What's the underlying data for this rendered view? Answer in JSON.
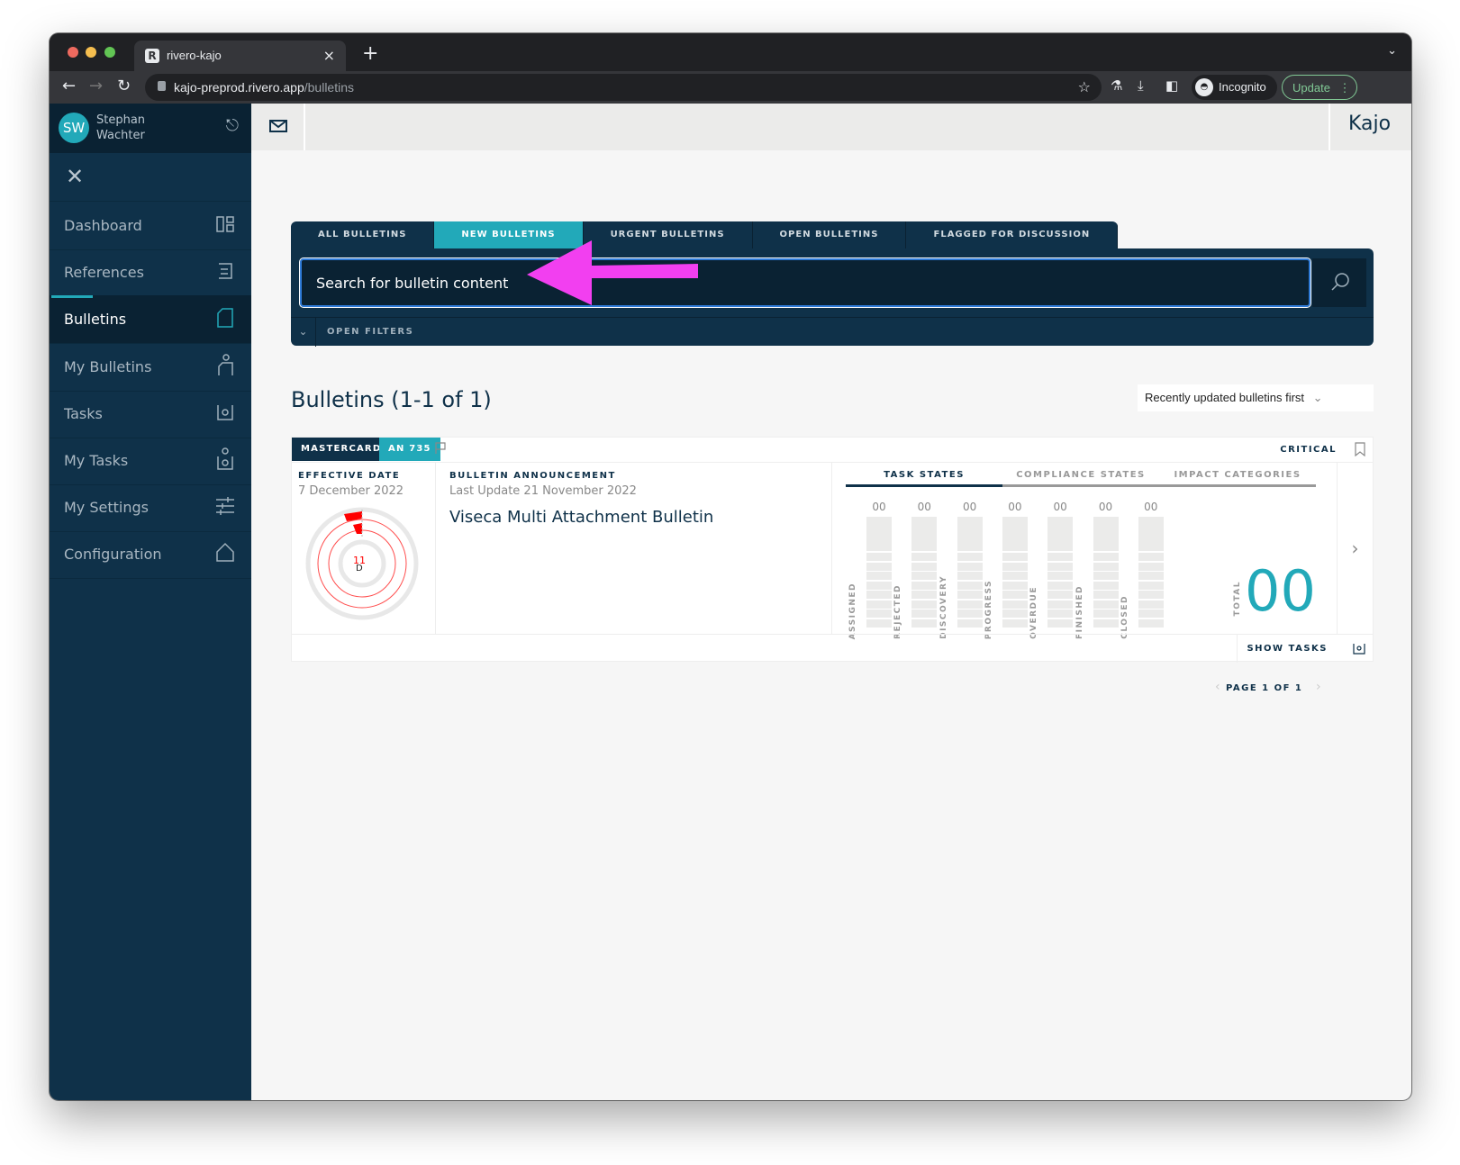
{
  "browser": {
    "tab_title": "rivero-kajo",
    "tab_favicon": "R",
    "url_host": "kajo-preprod.rivero.app",
    "url_path": "/bulletins",
    "profile_label": "Incognito",
    "update_label": "Update"
  },
  "user": {
    "initials": "SW",
    "first_name": "Stephan",
    "last_name": "Wachter"
  },
  "brand": "Kajo",
  "sidebar": {
    "items": [
      {
        "label": "Dashboard",
        "icon": "dashboard-icon"
      },
      {
        "label": "References",
        "icon": "references-icon"
      },
      {
        "label": "Bulletins",
        "icon": "bulletin-icon",
        "active": true
      },
      {
        "label": "My Bulletins",
        "icon": "my-bulletins-icon"
      },
      {
        "label": "Tasks",
        "icon": "tasks-icon"
      },
      {
        "label": "My Tasks",
        "icon": "my-tasks-icon"
      },
      {
        "label": "My Settings",
        "icon": "settings-sliders-icon"
      },
      {
        "label": "Configuration",
        "icon": "home-icon"
      }
    ]
  },
  "filter_tabs": [
    {
      "label": "ALL BULLETINS"
    },
    {
      "label": "NEW BULLETINS",
      "active": true
    },
    {
      "label": "URGENT BULLETINS"
    },
    {
      "label": "OPEN BULLETINS"
    },
    {
      "label": "FLAGGED FOR DISCUSSION"
    }
  ],
  "search": {
    "value": "Search for bulletin content",
    "open_filters_label": "OPEN FILTERS"
  },
  "results": {
    "title": "Bulletins (1-1 of 1)",
    "sort_label": "Recently updated bulletins first"
  },
  "bulletin": {
    "organization": "MASTERCARD",
    "id": "AN 735",
    "severity": "CRITICAL",
    "effective_date_label": "EFFECTIVE DATE",
    "effective_date": "7 December 2022",
    "countdown_value": "11",
    "countdown_unit": "D",
    "type_label": "BULLETIN ANNOUNCEMENT",
    "last_update": "Last Update 21 November 2022",
    "title": "Viseca Multi Attachment Bulletin",
    "state_tabs": [
      {
        "label": "TASK STATES",
        "active": true
      },
      {
        "label": "COMPLIANCE STATES"
      },
      {
        "label": "IMPACT CATEGORIES"
      }
    ],
    "task_states": [
      {
        "label": "ASSIGNED",
        "value": "00"
      },
      {
        "label": "REJECTED",
        "value": "00"
      },
      {
        "label": "DISCOVERY",
        "value": "00"
      },
      {
        "label": "PROGRESS",
        "value": "00"
      },
      {
        "label": "OVERDUE",
        "value": "00"
      },
      {
        "label": "FINISHED",
        "value": "00"
      },
      {
        "label": "CLOSED",
        "value": "00"
      }
    ],
    "total_label": "TOTAL",
    "total_value": "00",
    "show_tasks_label": "SHOW TASKS"
  },
  "pagination": {
    "label": "PAGE 1 OF 1"
  },
  "colors": {
    "sidebar_bg": "#0f3149",
    "accent_teal": "#22a9b9",
    "countdown_red": "#ff0000",
    "annotation_arrow": "#f23ff0"
  }
}
